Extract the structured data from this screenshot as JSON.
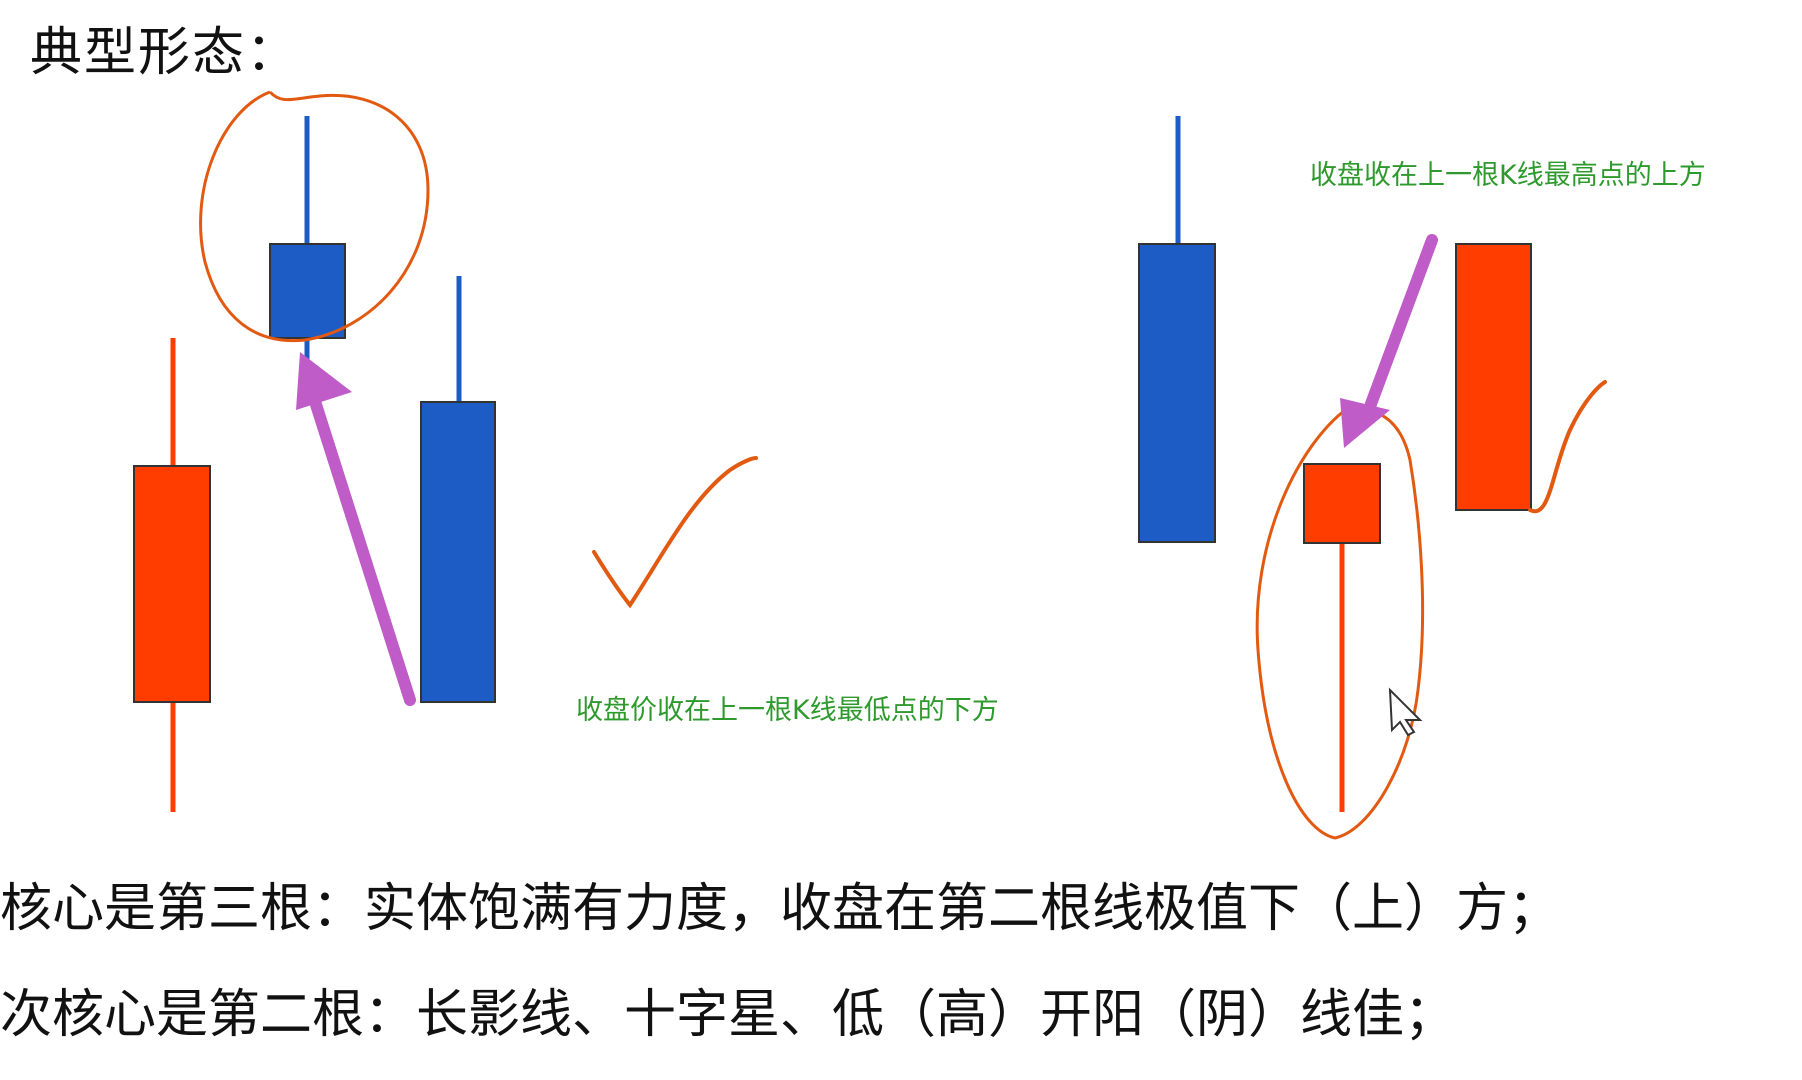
{
  "title": "典型形态：",
  "annotations": {
    "left_note": "收盘价收在上一根K线最低点的下方",
    "right_note": "收盘收在上一根K线最高点的上方"
  },
  "summary": {
    "line1": "核心是第三根：实体饱满有力度，收盘在第二根线极值下（上）方；",
    "line2": "次核心是第二根：长影线、十字星、低（高）开阳（阴）线佳；"
  },
  "colors": {
    "bearish_blue": "#1c5cc4",
    "bullish_red": "#ff3d00",
    "annotation_orange": "#e25a12",
    "arrow_purple": "#c05cc8",
    "note_green": "#2e9a2e"
  }
}
